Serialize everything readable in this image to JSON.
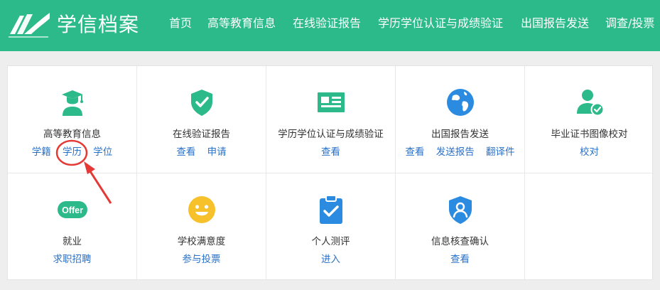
{
  "header": {
    "brand": "学信档案",
    "nav": [
      "首页",
      "高等教育信息",
      "在线验证报告",
      "学历学位认证与成绩验证",
      "出国报告发送",
      "调查/投票"
    ]
  },
  "services": [
    {
      "title": "高等教育信息",
      "icon": "graduate-icon",
      "links": [
        "学籍",
        "学历",
        "学位"
      ]
    },
    {
      "title": "在线验证报告",
      "icon": "shield-check-icon",
      "links": [
        "查看",
        "申请"
      ]
    },
    {
      "title": "学历学位认证与成绩验证",
      "icon": "certificate-card-icon",
      "links": [
        "查看"
      ]
    },
    {
      "title": "出国报告发送",
      "icon": "globe-icon",
      "links": [
        "查看",
        "发送报告",
        "翻译件"
      ]
    },
    {
      "title": "毕业证书图像校对",
      "icon": "user-check-icon",
      "links": [
        "校对"
      ]
    },
    {
      "title": "就业",
      "icon": "offer-icon",
      "icon_text": "Offer",
      "links": [
        "求职招聘"
      ]
    },
    {
      "title": "学校满意度",
      "icon": "smiley-icon",
      "links": [
        "参与投票"
      ]
    },
    {
      "title": "个人测评",
      "icon": "clipboard-check-icon",
      "links": [
        "进入"
      ]
    },
    {
      "title": "信息核查确认",
      "icon": "shield-user-icon",
      "links": [
        "查看"
      ]
    }
  ],
  "colors": {
    "brand_green": "#2dba8a",
    "icon_green": "#2dba8a",
    "icon_blue": "#2a8be0",
    "icon_yellow": "#f7c12b",
    "link_blue": "#2a72c9",
    "annotation_red": "#e53935"
  }
}
